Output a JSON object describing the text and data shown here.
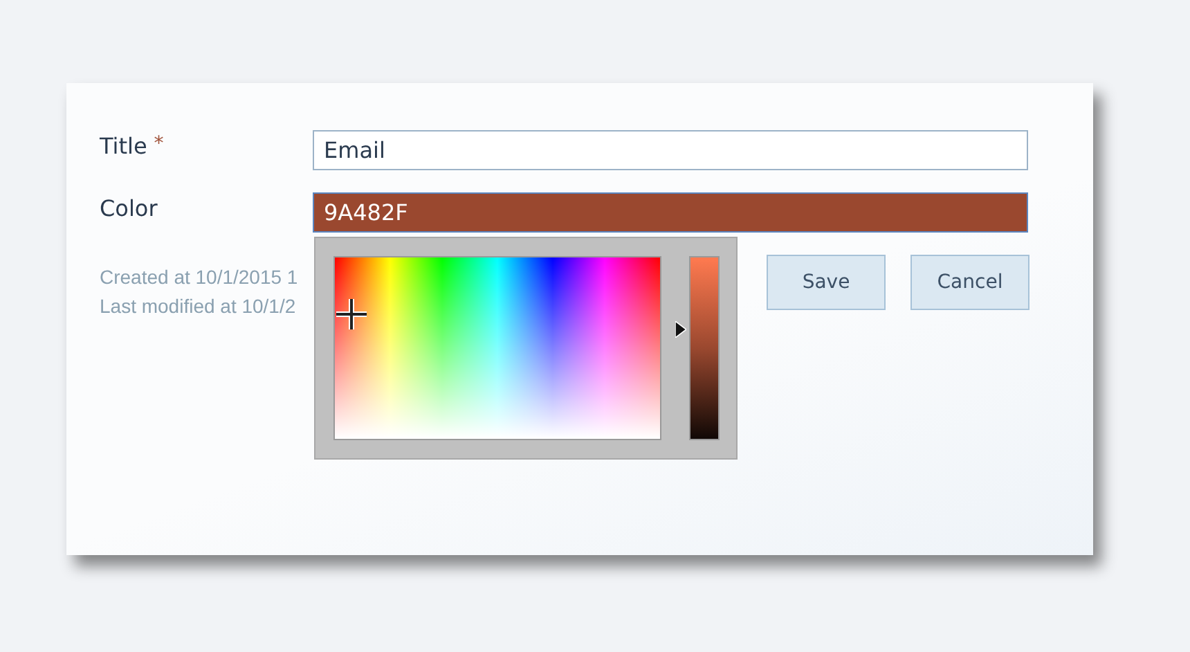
{
  "form": {
    "fields": [
      {
        "kind": "text",
        "label": "Title",
        "required_mark": "*",
        "value": "Email"
      },
      {
        "kind": "color",
        "label": "Color",
        "value": "9A482F"
      }
    ],
    "meta": [
      "Created at 10/1/2015 1",
      "Last modified at 10/1/2"
    ],
    "buttons": [
      "Save",
      "Cancel"
    ]
  },
  "color_picker": {
    "brightness": {
      "level": 0.6
    }
  }
}
